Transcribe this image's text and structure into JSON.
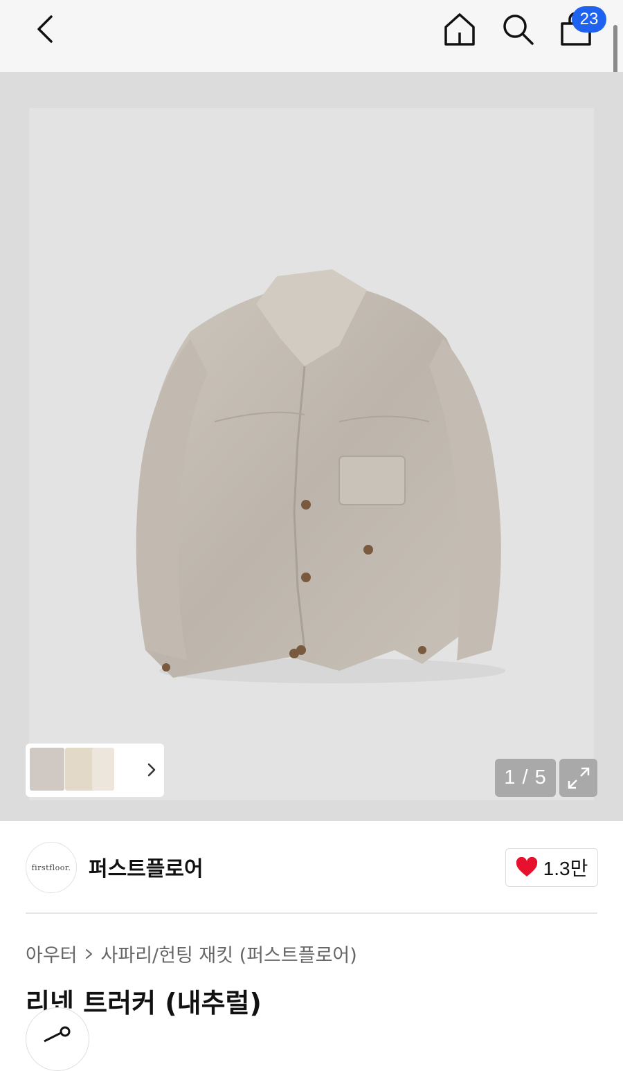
{
  "header": {
    "cart_count": "23"
  },
  "gallery": {
    "counter": "1 / 5"
  },
  "brand": {
    "logo_text": "firstfloor.",
    "name": "퍼스트플로어",
    "like_count": "1.3만"
  },
  "breadcrumb": {
    "category": "아우터",
    "subcategory": "사파리/헌팅 재킷 (퍼스트플로어)"
  },
  "product": {
    "title": "리넨 트러커 (내추럴)"
  },
  "colors": {
    "accent": "#1f62f0",
    "like_heart": "#e8112d"
  },
  "icons": [
    "chevron-left-icon",
    "home-icon",
    "search-icon",
    "shopping-bag-icon",
    "expand-icon",
    "chevron-right-icon",
    "heart-icon",
    "share-icon"
  ]
}
